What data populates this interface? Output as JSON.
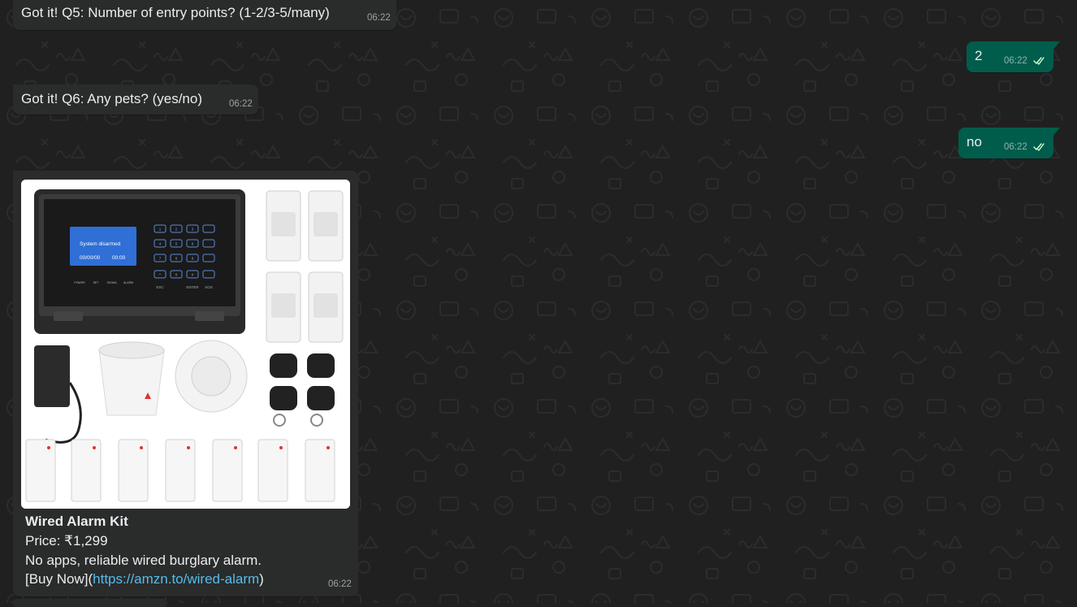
{
  "messages": [
    {
      "text": "Got it! Q5: Number of entry points? (1-2/3-5/many)",
      "time": "06:22"
    },
    {
      "text": "2",
      "time": "06:22"
    },
    {
      "text": "Got it! Q6: Any pets? (yes/no)",
      "time": "06:22"
    },
    {
      "text": "no",
      "time": "06:22"
    }
  ],
  "product_card": {
    "image_screen": {
      "status": "System disarmed",
      "date": "00/00/00",
      "clock": "00:00"
    },
    "image_panel_labels": [
      "POWER",
      "SET",
      "SIGNAL",
      "ALARM"
    ],
    "image_keypad": {
      "keys": [
        "1",
        "2",
        "3",
        "4",
        "5",
        "6",
        "7",
        "8",
        "9",
        "0",
        "*",
        "#"
      ],
      "bottom_keys": [
        "ESC",
        "ENTER",
        "SOS"
      ]
    },
    "title": "Wired Alarm Kit",
    "price": "Price: ₹1,299",
    "description": "No apps, reliable wired burglary alarm.",
    "cta_prefix": "[Buy Now](",
    "cta_link": "https://amzn.to/wired-alarm",
    "cta_suffix": ")",
    "time": "06:22"
  },
  "colors": {
    "background": "#202020",
    "incoming_bubble": "#2a2b2b",
    "outgoing_bubble": "#005c4b",
    "text": "#e9edef",
    "link": "#53bdeb",
    "read_ticks": "#ffffff"
  },
  "icons": [
    "double-check-read-icon",
    "chat-wallpaper-doodle"
  ]
}
